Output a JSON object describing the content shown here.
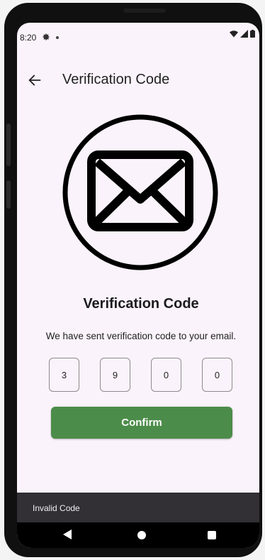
{
  "status_bar": {
    "time": "8:20"
  },
  "app_bar": {
    "title": "Verification Code"
  },
  "content": {
    "heading": "Verification Code",
    "subtitle": "We have sent verification code to your email.",
    "code_digits": [
      "3",
      "9",
      "0",
      "0"
    ],
    "confirm_label": "Confirm"
  },
  "snackbar": {
    "message": "Invalid Code"
  },
  "colors": {
    "background": "#fbf3fb",
    "confirm_button": "#4c8c4a",
    "snackbar": "#322f35",
    "text": "#1c1b1f"
  },
  "icons": [
    "gear-icon",
    "back-arrow-icon",
    "envelope-icon",
    "wifi-icon",
    "signal-icon",
    "battery-icon",
    "nav-back-icon",
    "nav-home-icon",
    "nav-recents-icon"
  ]
}
